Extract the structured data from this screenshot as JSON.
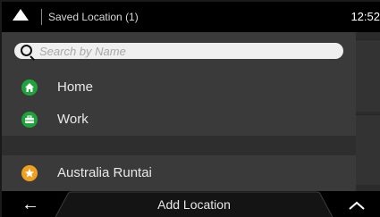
{
  "header": {
    "title": "Saved Location (1)",
    "clock": "12:52"
  },
  "search": {
    "placeholder": "Search by Name",
    "value": ""
  },
  "locations": [
    {
      "label": "Home",
      "icon": "home-icon",
      "color": "#1fa33a"
    },
    {
      "label": "Work",
      "icon": "briefcase-icon",
      "color": "#1fa33a"
    },
    {
      "label": "Australia Runtai",
      "icon": "star-icon",
      "color": "#f0a020"
    }
  ],
  "footer": {
    "add_label": "Add Location"
  }
}
